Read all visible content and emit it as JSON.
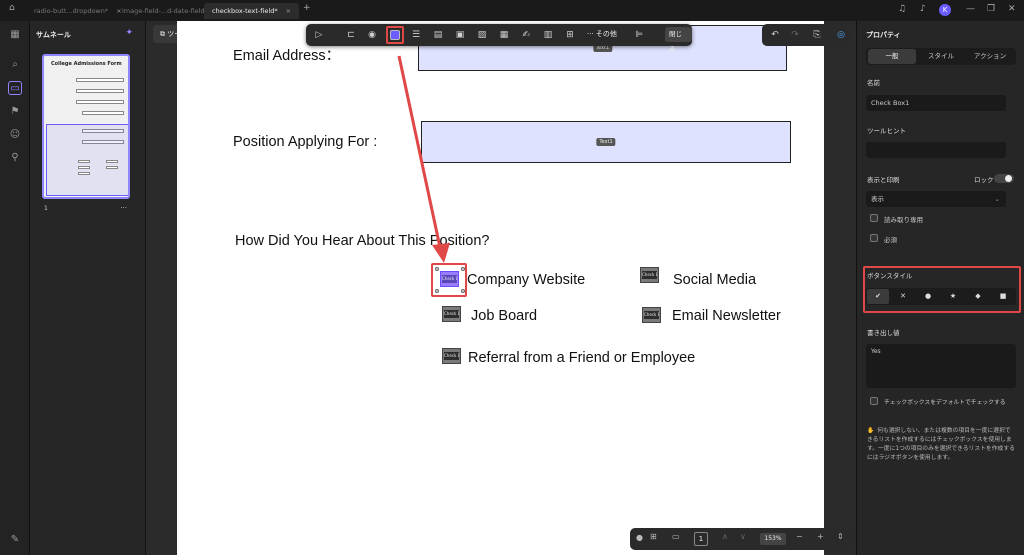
{
  "titlebar": {
    "tabs": [
      {
        "label": "radio-butt...dropdown*"
      },
      {
        "label": "image-field-...d-date-field"
      },
      {
        "label": "checkbox-text-field*",
        "active": true
      }
    ],
    "add_tab": "+",
    "avatar": "K"
  },
  "thumbnails": {
    "header": "サムネール",
    "page_label": "1",
    "more": "···",
    "thumb_title": "College Admissions Form"
  },
  "tool_button": "ツール",
  "floating_toolbar": {
    "more_label": "··· その他",
    "close_label": "閉じる"
  },
  "document": {
    "email_label": "Email Address：",
    "position_label": "Position Applying For :",
    "email_field_tag": "Text1",
    "position_field_tag": "Text1",
    "question": "How Did You Hear About This Position?",
    "checkbox_tag": "Check Box",
    "options": [
      "Company Website",
      "Social Media",
      "Job Board",
      "Email Newsletter",
      "Referral from a Friend or Employee"
    ]
  },
  "zoom_bar": {
    "page": "1",
    "zoom": "153%",
    "minus": "−",
    "plus": "+"
  },
  "properties": {
    "title": "プロパティ",
    "tabs": [
      "一般",
      "スタイル",
      "アクション"
    ],
    "name_label": "名前",
    "name_value": "Check Box1",
    "tooltip_label": "ツールヒント",
    "tooltip_value": "",
    "display_print_label": "表示と印刷",
    "lock_label": "ロック",
    "display_value": "表示",
    "readonly_label": "読み取り専用",
    "required_label": "必須",
    "button_style_label": "ボタンスタイル",
    "button_styles": [
      "✔",
      "✕",
      "●",
      "★",
      "◆",
      "■"
    ],
    "export_label": "書き出し値",
    "export_value": "Yes",
    "default_check_label": "チェックボックスをデフォルトでチェックする",
    "hint": "何も選択しない、または複数の項目を一度に選択できるリストを作成するにはチェックボックスを使用します。一度に1つの項目のみを選択できるリストを作成するにはラジオボタンを使用します。"
  },
  "colors": {
    "accent": "#8f86ff",
    "highlight_red": "#e04848",
    "field_fill": "#dfe2ff"
  }
}
